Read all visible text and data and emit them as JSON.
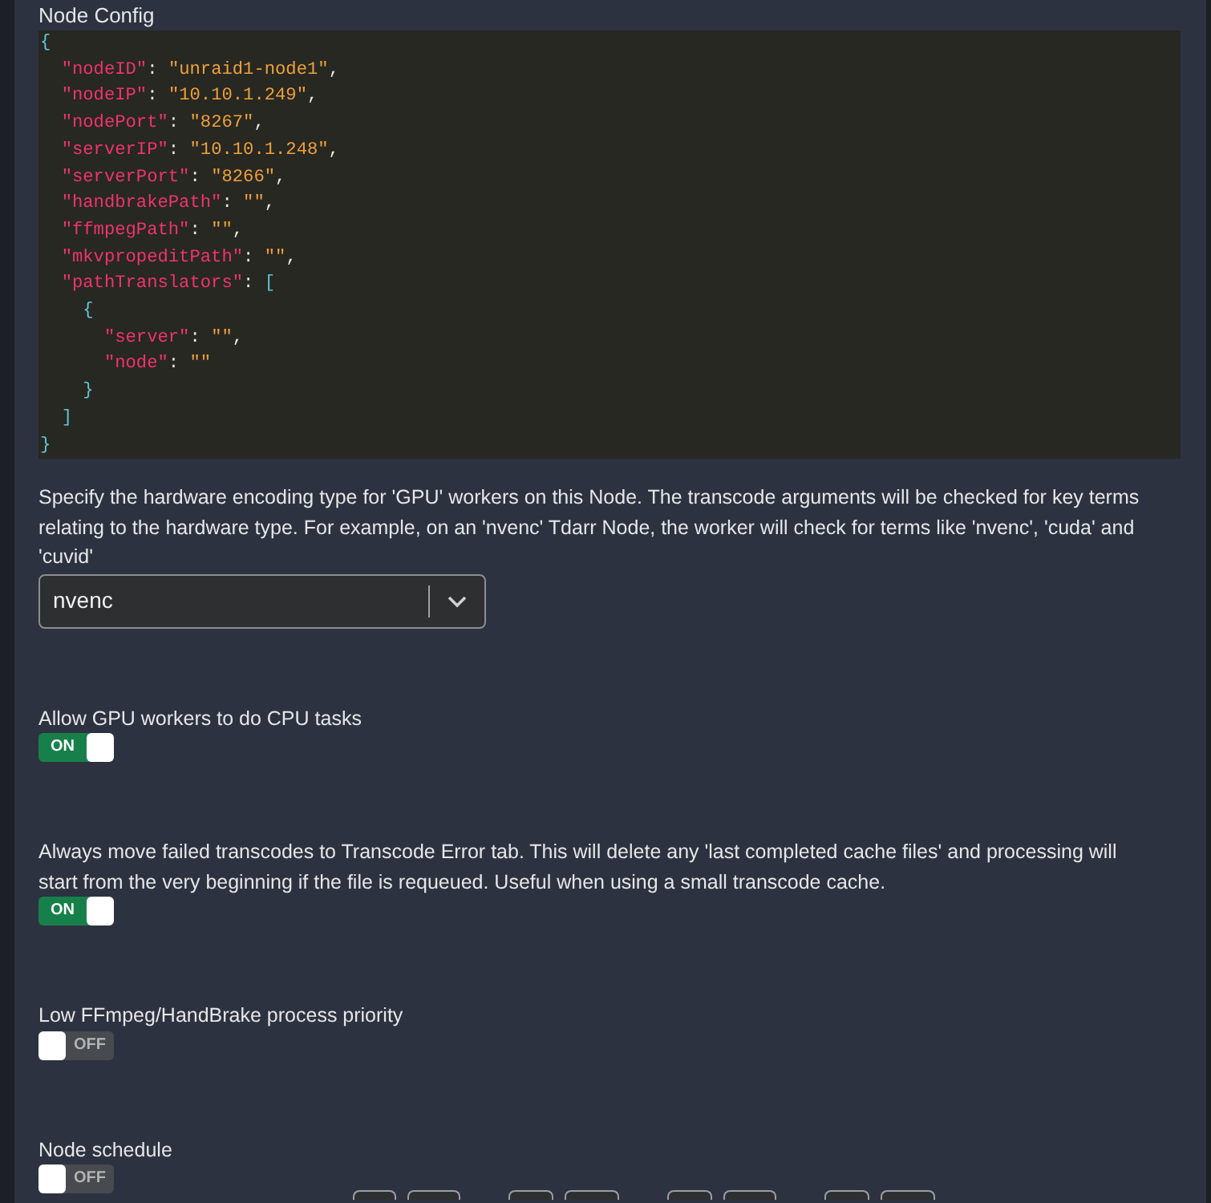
{
  "title": "Node Config",
  "code_block": {
    "text": "{\n  \"nodeID\": \"unraid1-node1\",\n  \"nodeIP\": \"10.10.1.249\",\n  \"nodePort\": \"8267\",\n  \"serverIP\": \"10.10.1.248\",\n  \"serverPort\": \"8266\",\n  \"handbrakePath\": \"\",\n  \"ffmpegPath\": \"\",\n  \"mkvpropeditPath\": \"\",\n  \"pathTranslators\": [\n    {\n      \"server\": \"\",\n      \"node\": \"\"\n    }\n  ]\n}"
  },
  "settings": [
    {
      "kind": "select",
      "label": "Specify the hardware encoding type for 'GPU' workers on this Node. The transcode arguments will be checked for key terms relating to the hardware type. For example, on an 'nvenc' Tdarr Node, the worker will check for terms like 'nvenc', 'cuda' and 'cuvid'",
      "value": "nvenc"
    },
    {
      "kind": "toggle",
      "label": "Allow GPU workers to do CPU tasks",
      "on": true,
      "state_text": "ON"
    },
    {
      "kind": "toggle",
      "label": "Always move failed transcodes to Transcode Error tab. This will delete any 'last completed cache files' and processing will start from the very beginning if the file is requeued. Useful when using a small transcode cache.",
      "on": true,
      "state_text": "ON"
    },
    {
      "kind": "toggle",
      "label": "Low FFmpeg/HandBrake process priority",
      "on": false,
      "state_text": "OFF"
    },
    {
      "kind": "toggle",
      "label": "Node schedule",
      "on": false,
      "state_text": "OFF"
    }
  ]
}
